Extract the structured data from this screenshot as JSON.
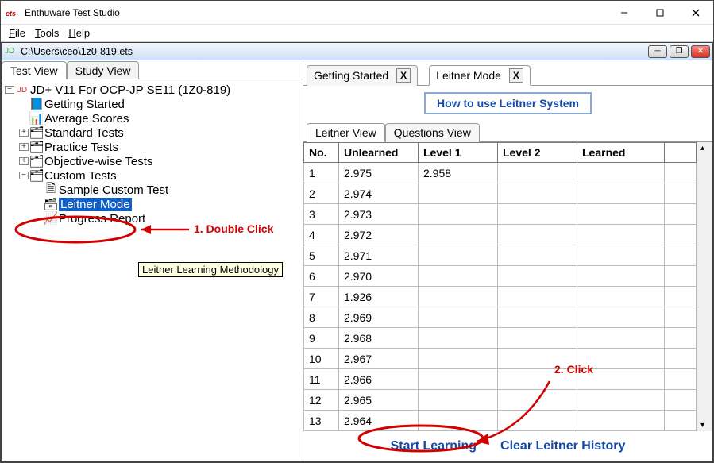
{
  "app": {
    "title": "Enthuware Test Studio",
    "iconText": "ets"
  },
  "menu": {
    "file": "File",
    "tools": "Tools",
    "help": "Help"
  },
  "doc": {
    "path": "C:\\Users\\ceo\\1z0-819.ets"
  },
  "leftTabs": {
    "test": "Test View",
    "study": "Study View"
  },
  "tree": {
    "root": "JD+ V11 For OCP-JP SE11 (1Z0-819)",
    "gettingStarted": "Getting Started",
    "averageScores": "Average Scores",
    "standardTests": "Standard Tests",
    "practiceTests": "Practice Tests",
    "objectiveWise": "Objective-wise Tests",
    "customTests": "Custom Tests",
    "sampleCustom": "Sample Custom Test",
    "leitnerMode": "Leitner Mode",
    "progressReport": "Progress Report"
  },
  "tooltip": "Leitner Learning Methodology",
  "rightTabs": {
    "gettingStarted": "Getting Started",
    "leitnerMode": "Leitner Mode"
  },
  "howTo": "How to use Leitner System",
  "subTabs": {
    "leitnerView": "Leitner View",
    "questionsView": "Questions View"
  },
  "table": {
    "headers": {
      "no": "No.",
      "unlearned": "Unlearned",
      "l1": "Level 1",
      "l2": "Level 2",
      "learned": "Learned"
    },
    "rows": [
      {
        "no": "1",
        "unlearned": "2.975",
        "l1": "2.958",
        "l2": "",
        "learned": ""
      },
      {
        "no": "2",
        "unlearned": "2.974",
        "l1": "",
        "l2": "",
        "learned": ""
      },
      {
        "no": "3",
        "unlearned": "2.973",
        "l1": "",
        "l2": "",
        "learned": ""
      },
      {
        "no": "4",
        "unlearned": "2.972",
        "l1": "",
        "l2": "",
        "learned": ""
      },
      {
        "no": "5",
        "unlearned": "2.971",
        "l1": "",
        "l2": "",
        "learned": ""
      },
      {
        "no": "6",
        "unlearned": "2.970",
        "l1": "",
        "l2": "",
        "learned": ""
      },
      {
        "no": "7",
        "unlearned": "1.926",
        "l1": "",
        "l2": "",
        "learned": ""
      },
      {
        "no": "8",
        "unlearned": "2.969",
        "l1": "",
        "l2": "",
        "learned": ""
      },
      {
        "no": "9",
        "unlearned": "2.968",
        "l1": "",
        "l2": "",
        "learned": ""
      },
      {
        "no": "10",
        "unlearned": "2.967",
        "l1": "",
        "l2": "",
        "learned": ""
      },
      {
        "no": "11",
        "unlearned": "2.966",
        "l1": "",
        "l2": "",
        "learned": ""
      },
      {
        "no": "12",
        "unlearned": "2.965",
        "l1": "",
        "l2": "",
        "learned": ""
      },
      {
        "no": "13",
        "unlearned": "2.964",
        "l1": "",
        "l2": "",
        "learned": ""
      }
    ]
  },
  "buttons": {
    "start": "Start Learning",
    "clear": "Clear Leitner History"
  },
  "annotations": {
    "a1": "1. Double Click",
    "a2": "2. Click"
  }
}
